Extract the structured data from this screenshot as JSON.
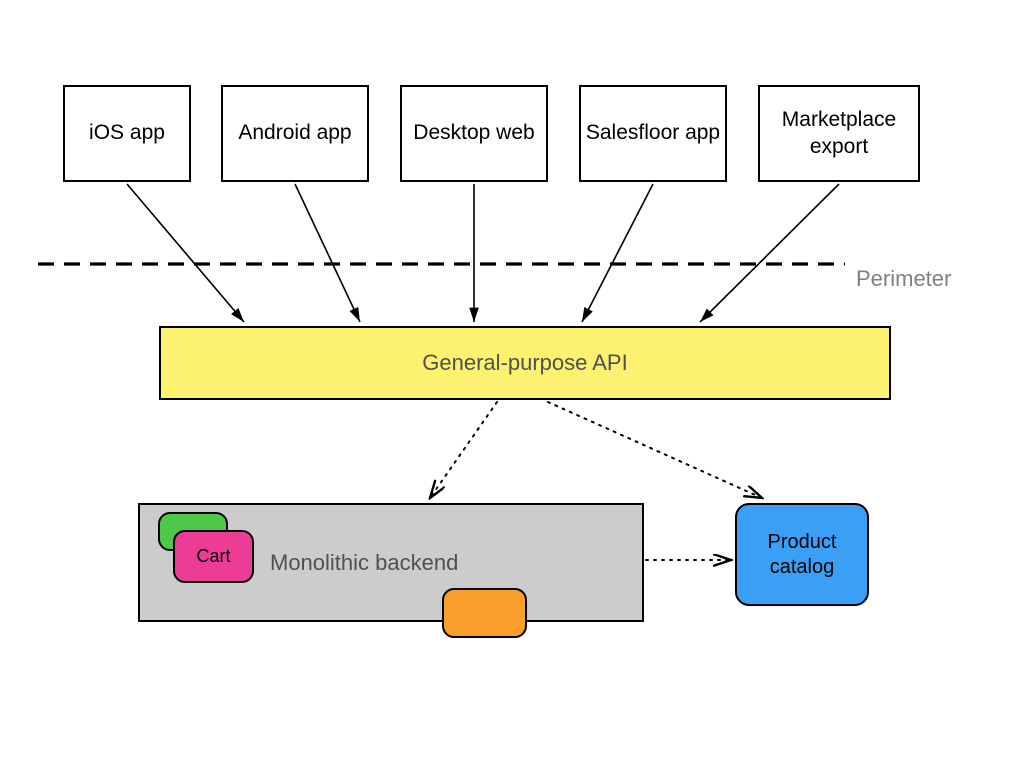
{
  "clients": {
    "ios": "iOS app",
    "android": "Android app",
    "desktop": "Desktop web",
    "salesfloor": "Salesfloor app",
    "marketplace": "Marketplace export"
  },
  "perimeter_label": "Perimeter",
  "api_label": "General-purpose API",
  "backend_label": "Monolithic backend",
  "cart_label": "Cart",
  "catalog_label": "Product catalog"
}
